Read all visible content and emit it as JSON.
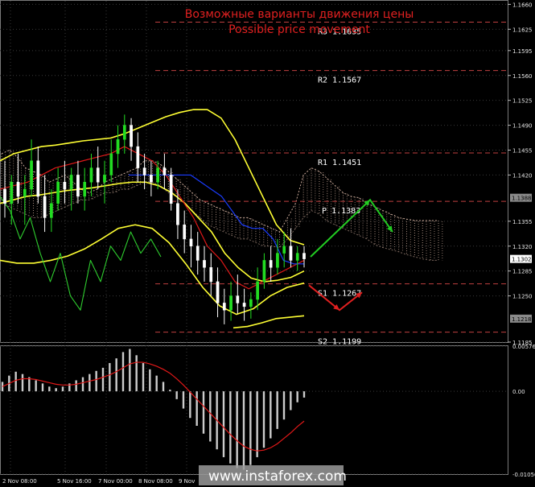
{
  "chart_data": [
    {
      "type": "candlestick",
      "title": "Возможные варианты движения цены",
      "subtitle": "Possible price movement",
      "ylim": [
        1.1185,
        1.1665
      ],
      "y_ticks": [
        1.166,
        1.1625,
        1.1595,
        1.156,
        1.1525,
        1.149,
        1.1455,
        1.142,
        1.1355,
        1.132,
        1.1285,
        1.125,
        1.1185
      ],
      "x_ticks": [
        "2 Nov 08:00",
        "5 Nov 16:00",
        "7 Nov 00:00",
        "8 Nov 08:00",
        "9 Nov"
      ],
      "current_price": "1.1302",
      "price_tags": [
        "1.1388",
        "1.1218"
      ],
      "levels": [
        {
          "name": "R3",
          "value": "1.1635"
        },
        {
          "name": "R2",
          "value": "1.1567"
        },
        {
          "name": "R1",
          "value": "1.1451"
        },
        {
          "name": "P",
          "value": "1.1383"
        },
        {
          "name": "S1",
          "value": "1.1267"
        },
        {
          "name": "S2",
          "value": "1.1199"
        }
      ],
      "candles": [
        [
          1.14,
          1.144,
          1.136,
          1.138
        ],
        [
          1.138,
          1.142,
          1.135,
          1.141
        ],
        [
          1.141,
          1.145,
          1.138,
          1.139
        ],
        [
          1.139,
          1.142,
          1.135,
          1.14
        ],
        [
          1.14,
          1.147,
          1.139,
          1.144
        ],
        [
          1.144,
          1.146,
          1.138,
          1.139
        ],
        [
          1.139,
          1.142,
          1.134,
          1.136
        ],
        [
          1.136,
          1.14,
          1.134,
          1.138
        ],
        [
          1.138,
          1.143,
          1.137,
          1.141
        ],
        [
          1.141,
          1.144,
          1.138,
          1.14
        ],
        [
          1.14,
          1.143,
          1.137,
          1.142
        ],
        [
          1.142,
          1.144,
          1.138,
          1.139
        ],
        [
          1.139,
          1.143,
          1.137,
          1.141
        ],
        [
          1.141,
          1.145,
          1.139,
          1.143
        ],
        [
          1.143,
          1.146,
          1.14,
          1.141
        ],
        [
          1.141,
          1.144,
          1.138,
          1.142
        ],
        [
          1.142,
          1.147,
          1.141,
          1.145
        ],
        [
          1.145,
          1.149,
          1.143,
          1.147
        ],
        [
          1.147,
          1.1505,
          1.145,
          1.149
        ],
        [
          1.149,
          1.15,
          1.144,
          1.146
        ],
        [
          1.146,
          1.148,
          1.141,
          1.143
        ],
        [
          1.143,
          1.145,
          1.14,
          1.142
        ],
        [
          1.142,
          1.144,
          1.139,
          1.141
        ],
        [
          1.141,
          1.144,
          1.14,
          1.143
        ],
        [
          1.143,
          1.145,
          1.14,
          1.142
        ],
        [
          1.142,
          1.143,
          1.137,
          1.138
        ],
        [
          1.138,
          1.14,
          1.133,
          1.135
        ],
        [
          1.135,
          1.137,
          1.131,
          1.133
        ],
        [
          1.133,
          1.135,
          1.129,
          1.132
        ],
        [
          1.132,
          1.134,
          1.128,
          1.13
        ],
        [
          1.13,
          1.132,
          1.127,
          1.129
        ],
        [
          1.129,
          1.131,
          1.125,
          1.127
        ],
        [
          1.127,
          1.129,
          1.122,
          1.124
        ],
        [
          1.124,
          1.126,
          1.121,
          1.123
        ],
        [
          1.123,
          1.127,
          1.1215,
          1.125
        ],
        [
          1.125,
          1.128,
          1.1225,
          1.124
        ],
        [
          1.124,
          1.126,
          1.1215,
          1.1235
        ],
        [
          1.1235,
          1.1255,
          1.1218,
          1.1245
        ],
        [
          1.1245,
          1.129,
          1.123,
          1.127
        ],
        [
          1.127,
          1.131,
          1.126,
          1.13
        ],
        [
          1.13,
          1.132,
          1.127,
          1.129
        ],
        [
          1.129,
          1.133,
          1.128,
          1.131
        ],
        [
          1.131,
          1.134,
          1.129,
          1.132
        ],
        [
          1.132,
          1.1345,
          1.129,
          1.13
        ],
        [
          1.13,
          1.132,
          1.1285,
          1.131
        ],
        [
          1.131,
          1.132,
          1.129,
          1.1302
        ]
      ],
      "scenario_up": [
        [
          1.1305,
          1.1385,
          1.134
        ]
      ],
      "scenario_down": [
        [
          1.1265,
          1.123,
          1.1255
        ]
      ]
    },
    {
      "type": "bar",
      "y_ticks": [
        "0.00576",
        "0.00",
        "-0.01056"
      ],
      "ylim": [
        -0.01056,
        0.00576
      ],
      "values": [
        0.0012,
        0.002,
        0.0025,
        0.0022,
        0.0018,
        0.0014,
        0.001,
        0.0006,
        0.0004,
        0.0006,
        0.001,
        0.0014,
        0.0018,
        0.0022,
        0.0026,
        0.003,
        0.0036,
        0.0042,
        0.005,
        0.0054,
        0.0046,
        0.0036,
        0.0028,
        0.002,
        0.0012,
        0.0002,
        -0.001,
        -0.0022,
        -0.0034,
        -0.0044,
        -0.0054,
        -0.0064,
        -0.0074,
        -0.0084,
        -0.0092,
        -0.0098,
        -0.01,
        -0.0094,
        -0.0084,
        -0.0072,
        -0.006,
        -0.0048,
        -0.0036,
        -0.0024,
        -0.0014,
        -0.0008
      ],
      "signal": [
        0.0006,
        0.001,
        0.0014,
        0.0016,
        0.0016,
        0.0015,
        0.0013,
        0.0011,
        0.0009,
        0.0008,
        0.0008,
        0.0009,
        0.0011,
        0.0013,
        0.0015,
        0.0018,
        0.0021,
        0.0025,
        0.003,
        0.0035,
        0.0037,
        0.0037,
        0.0035,
        0.0032,
        0.0028,
        0.0023,
        0.0016,
        0.0008,
        -0.0001,
        -0.001,
        -0.0019,
        -0.0028,
        -0.0037,
        -0.0046,
        -0.0055,
        -0.0063,
        -0.007,
        -0.0074,
        -0.0076,
        -0.0075,
        -0.0072,
        -0.0067,
        -0.006,
        -0.0053,
        -0.0045,
        -0.0038
      ]
    }
  ],
  "watermark": "www.instaforex.com",
  "colors": {
    "bull": "#22dd22",
    "bear": "#ffffff",
    "grid": "#3a3a3a",
    "level": "#c04040",
    "bollinger": "#ffff33",
    "ma_red": "#e01818",
    "ma_blue": "#1a3cff",
    "ma_green": "#2ecc2e",
    "cloud": "#c8a898",
    "title": "#e02020",
    "macd_bar": "#cccccc",
    "macd_signal": "#e01818",
    "arrow_up": "#22cc22",
    "arrow_down": "#e02020"
  }
}
